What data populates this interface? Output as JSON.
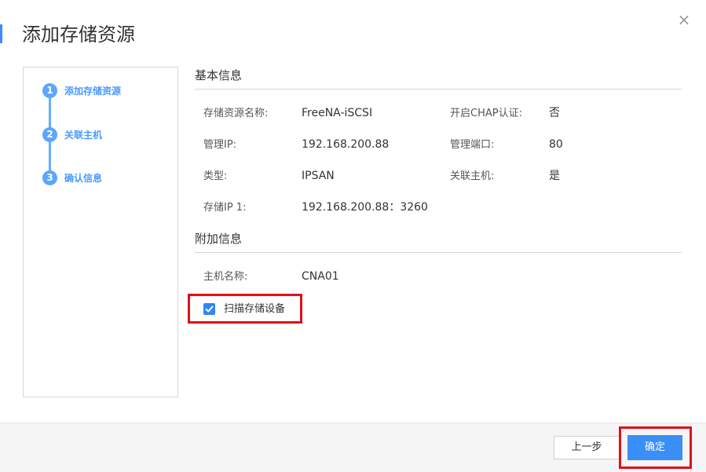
{
  "dialog": {
    "title": "添加存储资源",
    "close_glyph": "×"
  },
  "steps": [
    {
      "num": "1",
      "label": "添加存储资源"
    },
    {
      "num": "2",
      "label": "关联主机"
    },
    {
      "num": "3",
      "label": "确认信息"
    }
  ],
  "basic_info": {
    "title": "基本信息",
    "fields": [
      {
        "label": "存储资源名称:",
        "value": "FreeNA-iSCSI"
      },
      {
        "label": "开启CHAP认证:",
        "value": "否"
      },
      {
        "label": "管理IP:",
        "value": "192.168.200.88"
      },
      {
        "label": "管理端口:",
        "value": "80"
      },
      {
        "label": "类型:",
        "value": "IPSAN"
      },
      {
        "label": "关联主机:",
        "value": "是"
      },
      {
        "label": "存储IP 1:",
        "value": "192.168.200.88：3260"
      }
    ]
  },
  "extra_info": {
    "title": "附加信息",
    "fields": [
      {
        "label": "主机名称:",
        "value": "CNA01"
      }
    ]
  },
  "scan_checkbox": {
    "label": "扫描存储设备",
    "checked": true
  },
  "footer": {
    "prev_label": "上一步",
    "ok_label": "确定"
  },
  "colors": {
    "accent": "#3a8ff7",
    "step_blue": "#5ba6ff",
    "highlight_red": "#e0101a"
  }
}
